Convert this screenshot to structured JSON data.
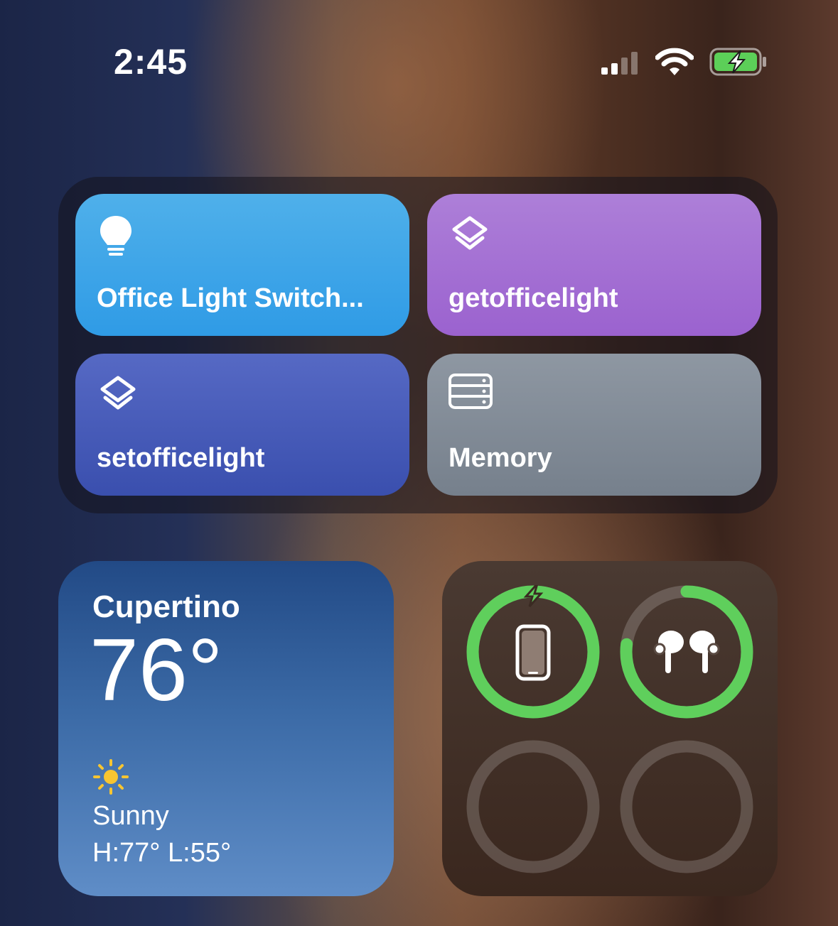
{
  "status_bar": {
    "time": "2:45",
    "signal_icon": "cellular-signal-icon",
    "wifi_icon": "wifi-icon",
    "battery_icon": "battery-charging-icon",
    "battery_color": "#5ccf58"
  },
  "shortcuts_widget": {
    "tiles": [
      {
        "label": "Office Light Switch...",
        "icon": "lightbulb-icon",
        "color": "#3ea6e8"
      },
      {
        "label": "getofficelight",
        "icon": "shortcuts-icon",
        "color": "#a46ed4"
      },
      {
        "label": "setofficelight",
        "icon": "shortcuts-icon",
        "color": "#4a5cba"
      },
      {
        "label": "Memory",
        "icon": "memory-icon",
        "color": "#838c97"
      }
    ]
  },
  "weather_widget": {
    "city": "Cupertino",
    "temperature": "76°",
    "condition_icon": "sun-icon",
    "condition": "Sunny",
    "high_low": "H:77° L:55°"
  },
  "batteries_widget": {
    "devices": [
      {
        "icon": "iphone-icon",
        "level": 1.0,
        "charging": true
      },
      {
        "icon": "airpods-icon",
        "level": 0.77,
        "charging": false
      },
      {
        "icon": "",
        "level": 0,
        "charging": false
      },
      {
        "icon": "",
        "level": 0,
        "charging": false
      }
    ],
    "ring_color": "#5fcf5c"
  }
}
